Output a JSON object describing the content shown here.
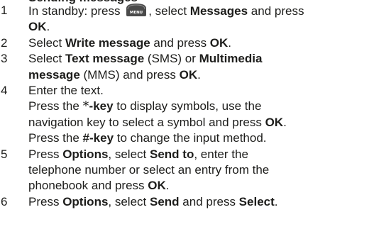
{
  "heading": "Sending messages",
  "menu_key": {
    "icon": "menu-key-icon",
    "label": "MENU",
    "color": "#4a4a4a"
  },
  "steps": [
    {
      "num": "1",
      "l1_a": "In standby: press ",
      "l1_b": ", select ",
      "l1_c": "Messages",
      "l1_d": " and press",
      "l2_a": "OK",
      "l2_b": "."
    },
    {
      "num": "2",
      "a": "Select ",
      "b": "Write message",
      "c": " and press ",
      "d": "OK",
      "e": "."
    },
    {
      "num": "3",
      "l1_a": "Select ",
      "l1_b": "Text message",
      "l1_c": " (SMS) or ",
      "l1_d": "Multimedia",
      "l2_a": "message",
      "l2_b": " (MMS) and press ",
      "l2_c": "OK",
      "l2_d": "."
    },
    {
      "num": "4",
      "l1": "Enter the text.",
      "l2_a": "Press the ",
      "l2_star": "*",
      "l2_key": "-key",
      "l2_b": " to display symbols, use the",
      "l3_a": "navigation key to select a symbol and press ",
      "l3_b": "OK",
      "l3_c": ".",
      "l4_a": "Press the ",
      "l4_b": "#-key",
      "l4_c": " to change the input method."
    },
    {
      "num": "5",
      "l1_a": "Press ",
      "l1_b": "Options",
      "l1_c": ", select ",
      "l1_d": "Send to",
      "l1_e": ", enter the",
      "l2": "telephone number or select an entry from the",
      "l3_a": "phonebook and press ",
      "l3_b": "OK",
      "l3_c": "."
    },
    {
      "num": "6",
      "a": "Press ",
      "b": "Options",
      "c": ", select ",
      "d": "Send",
      "e": " and press ",
      "f": "Select",
      "g": "."
    }
  ]
}
